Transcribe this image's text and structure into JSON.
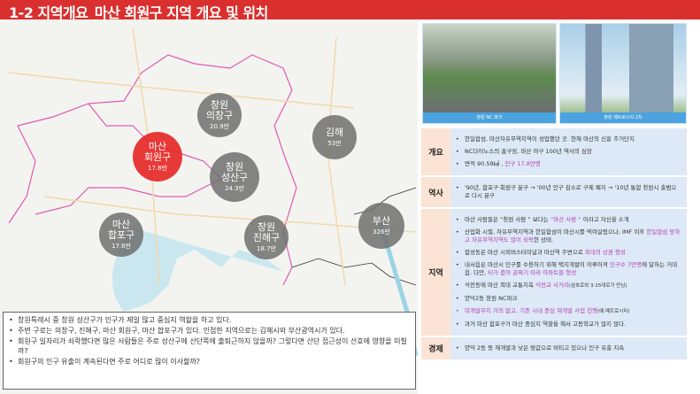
{
  "title": "1-2 지역개요_마산 회원구 지역 개요 및 위치",
  "map": {
    "bubbles": [
      {
        "name": "창원\n의창구",
        "line1": "창원",
        "line2": "의창구",
        "pop": "20.9만"
      },
      {
        "line1": "김해",
        "pop": "53만"
      },
      {
        "line1": "마산",
        "line2": "회원구",
        "pop": "17.8만"
      },
      {
        "line1": "창원",
        "line2": "성산구",
        "pop": "24.3만"
      },
      {
        "line1": "마산",
        "line2": "합포구",
        "pop": "17.6만"
      },
      {
        "line1": "창원",
        "line2": "진해구",
        "pop": "18.7만"
      },
      {
        "line1": "부산",
        "pop": "326만"
      }
    ]
  },
  "notes": [
    "창원특례시 중 창원 성산구가 인구가 제일 많고 중심지 역할을 하고 있다.",
    "주변 구로는 의창구, 진해구, 마산 회원구, 마산 합포구가 있다. 인접한 지역으로는 김해시와 부산광역시가 있다.",
    "회원구 일자리가 쇠락했다면 많은 사람들은 주로 성산구에 산단쪽에 출퇴근하지 않을까? 그렇다면 산단 접근성이 선호에 영향을 미칠까?",
    "회원구의 인구 유출이 계속된다면 주로 어디로 많이 이사할까?"
  ],
  "photos": [
    {
      "caption": "창원 NC 파크"
    },
    {
      "caption": "창원 메트로시티 2차"
    }
  ],
  "table": {
    "overview": {
      "label": "개요",
      "items": [
        "한일합섬, 마산자유무역지역이 성업했던 곳. 현재 마산의 신흥 주거단지",
        "NC다이노스의 홈구장, 마산 야구 100년 역사의 심장"
      ],
      "area": "면적 90.59㎢ , ",
      "pop": "인구 17.8만명"
    },
    "history": {
      "label": "역사",
      "items": [
        "'90년, 합포구·회원구 분구 → '00년 인구 감소로 구제 폐지 → '10년 통합 창원시 출범으로 다시 분구"
      ]
    },
    "region": {
      "label": "지역",
      "i1a": "마산 사람들은 “창원 사람 ” 보다는 ",
      "i1b": "“마산 사람 ”",
      "i1c": " 이라고 자신을 소개",
      "i2a": "산업화 시절, 자유무역지역과 한일합섬이 마산시를 먹여살렸으나, IMF 이후 ",
      "i2b": "한일합섬 망하고 자유무역지역도 많이 쇠락",
      "i2c": "한 상태.",
      "i3a": "합성동은 마산 시외버스터미널과 마산역 주변으로 ",
      "i3b": "최대의 상권 형성",
      "i4a": "내서읍은 마산시 인구를 수용하기 위해 택지개발이 이루어져 ",
      "i4b": "인구수 7만명",
      "i4c": "에 달하는 거대 읍. 다만, ",
      "i4d": "터가 좁아 골짜기 따라 아파트들 형성",
      "i5a": "석전동에 마산 최대 교통지옥 ",
      "i5b": "석전교 사거리",
      "i5c": "(삼호로와 3·15대로가 만남)",
      "i6": "양덕2동 창원 NC파크",
      "i7a": "미개발부지 거의 없고, 기존 시내 중심 재개발 사업 진행",
      "i7b": "(예.메트로시티)",
      "i8": "과거 마산 합포구가 마산 중심지 역할을 해서 고등학교가 많지 않다."
    },
    "economy": {
      "label": "경제",
      "items": [
        "양덕 2동 등 재개발과 낮은 땅값으로 버티고 있으나 인구 유출 지속"
      ]
    }
  },
  "colors": {
    "title": "#d9302f",
    "highlight": "#b43fb0",
    "bubble": "#6e6e6e",
    "active_bubble": "#e62828"
  }
}
